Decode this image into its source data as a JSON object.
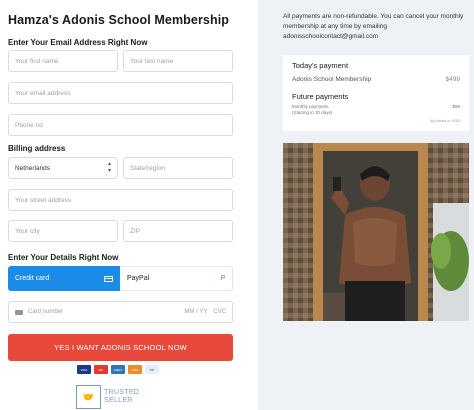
{
  "title": "Hamza's Adonis School Membership",
  "sections": {
    "email": "Enter Your Email Address Right Now",
    "billing": "Billing address",
    "details": "Enter Your Details Right Now"
  },
  "fields": {
    "first_name": "Your first name",
    "last_name": "Your last name",
    "email": "Your email address",
    "phone": "Phone no",
    "country": "Netherlands",
    "state": "State/region",
    "street": "Your street address",
    "city": "Your city",
    "zip": "ZIP"
  },
  "payment": {
    "credit_card": "Credit card",
    "paypal": "PayPal",
    "paypal_glyph": "P",
    "card_number": "Card number",
    "expiry": "MM / YY",
    "cvc": "CVC"
  },
  "cta": "YES I WANT ADONIS SCHOOL NOW",
  "card_logos": [
    "VISA",
    "MC",
    "AMEX",
    "DISC",
    "PP"
  ],
  "trusted": {
    "line1": "TRUSTED",
    "line2": "SELLER"
  },
  "notice": "All payments are non-refundable. You can cancel your monthly membership at any time by emailing adonisschoolcontact@gmail.com",
  "summary": {
    "today_label": "Today's payment",
    "item": "Adonis School Membership",
    "item_price": "$499",
    "future_label": "Future payments",
    "future_item": "Monthly payments",
    "future_note": "(Starting in 30 days)",
    "future_price": "$99",
    "fine_print": "All prices in USD"
  },
  "colors": {
    "accent": "#1a8ce8",
    "cta": "#e8493a",
    "panel": "#eef2f6"
  }
}
